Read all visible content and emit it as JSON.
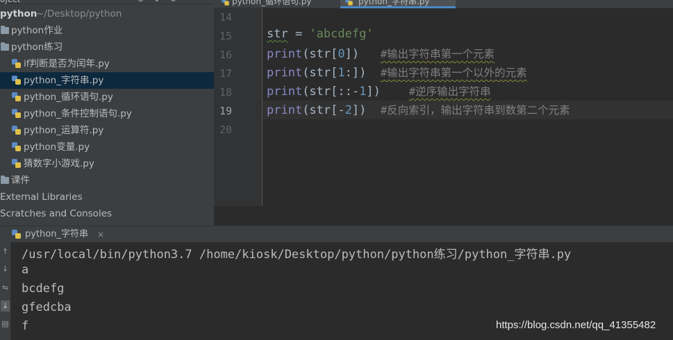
{
  "project_panel": {
    "header": {
      "title": "oject",
      "icons": [
        "crosshair-icon",
        "collapse-icon",
        "gear-icon"
      ]
    },
    "root": {
      "name": "python",
      "path": "~/Desktop/python"
    },
    "items": [
      {
        "label": "python作业",
        "type": "folder"
      },
      {
        "label": "python练习",
        "type": "folder"
      },
      {
        "label": "if判断是否为闰年.py",
        "type": "file"
      },
      {
        "label": "python_字符串.py",
        "type": "file",
        "selected": true
      },
      {
        "label": "python_循环语句.py",
        "type": "file"
      },
      {
        "label": "python_条件控制语句.py",
        "type": "file"
      },
      {
        "label": "python_运算符.py",
        "type": "file"
      },
      {
        "label": "python变量.py",
        "type": "file"
      },
      {
        "label": "猜数字小游戏.py",
        "type": "file"
      },
      {
        "label": "课件",
        "type": "folder"
      },
      {
        "label": "External Libraries",
        "type": "library"
      },
      {
        "label": "Scratches and Consoles",
        "type": "scratches"
      }
    ]
  },
  "editor_tabs": [
    {
      "label": "python_循环语句.py",
      "active": false
    },
    {
      "label": "python_字符串.py",
      "active": true
    }
  ],
  "editor": {
    "line_numbers": [
      "14",
      "15",
      "16",
      "17",
      "18",
      "19",
      "20"
    ],
    "current_line": "19",
    "lines": {
      "l15": {
        "var": "str",
        "eq": " = ",
        "str": "'abcdefg'"
      },
      "l16": {
        "fn": "print",
        "a": "(str[",
        "n": "0",
        "b": "])",
        "gap": "   ",
        "comment": "#输出字符串第一个元素"
      },
      "l17": {
        "fn": "print",
        "a": "(str[",
        "n": "1",
        "b": ":])",
        "gap": "  ",
        "comment": "#输出字符串第一个以外的元素"
      },
      "l18": {
        "fn": "print",
        "a": "(str[::-",
        "n": "1",
        "b": "])",
        "gap": "    ",
        "comment": "#逆序输出字符串"
      },
      "l19": {
        "fn": "print",
        "a": "(str[-",
        "n": "2",
        "b": "])",
        "gap": "  ",
        "comment": "#反向索引，输出字符串到数第二个元素"
      }
    }
  },
  "run_panel": {
    "tab": {
      "label": "python_字符串",
      "close": "×"
    },
    "side_icons": [
      "up-arrow-icon",
      "down-arrow-icon",
      "soft-wrap-icon",
      "scroll-to-end-icon",
      "print-icon"
    ],
    "output": [
      "/usr/local/bin/python3.7 /home/kiosk/Desktop/python/python练习/python_字符串.py",
      "a",
      "bcdefg",
      "gfedcba",
      "f"
    ]
  },
  "watermark": "https://blog.csdn.net/qq_41355482"
}
